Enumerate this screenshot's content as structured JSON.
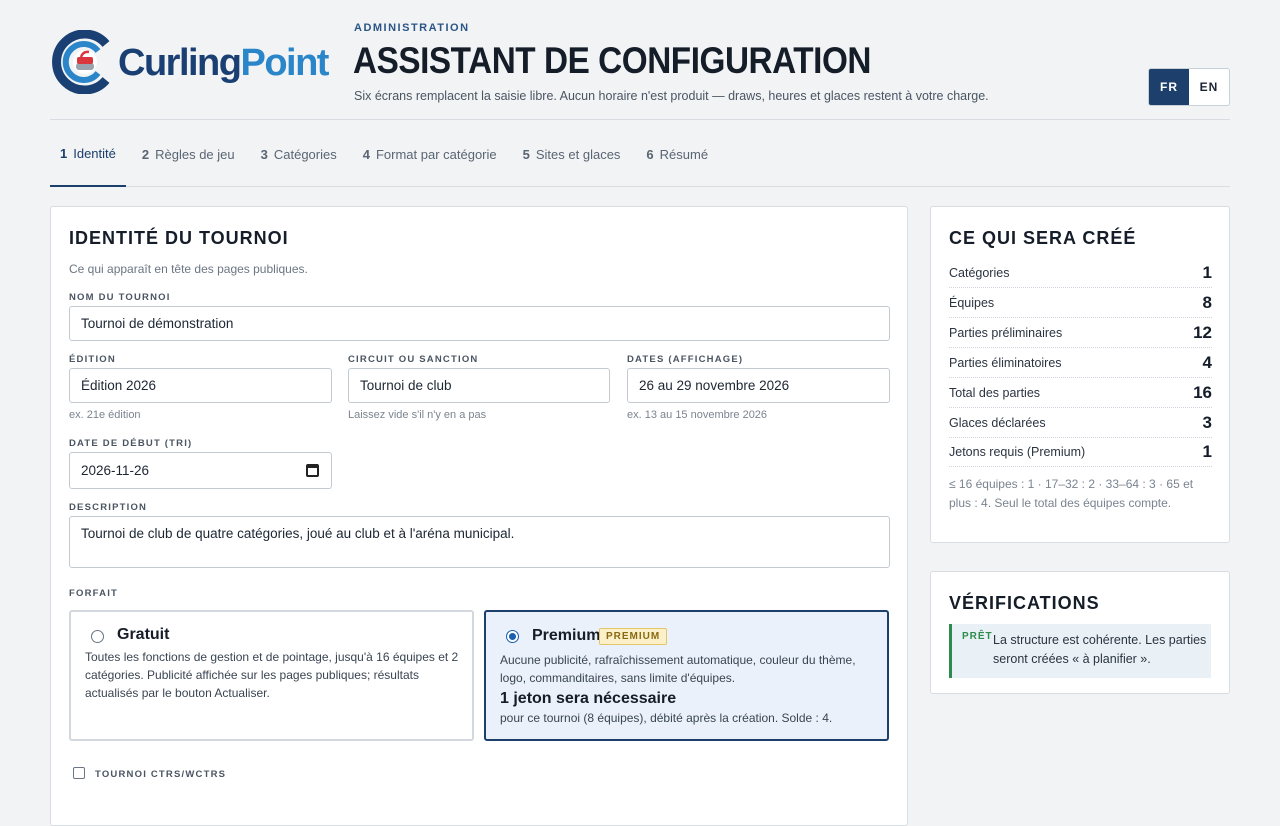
{
  "brand": {
    "name_part1": "Curling",
    "name_part2": "Point",
    "colors": {
      "navy": "#1a3f73",
      "blue": "#2a86c9",
      "accent_red": "#d9363e"
    }
  },
  "header": {
    "kicker": "ADMINISTRATION",
    "title": "ASSISTANT DE CONFIGURATION",
    "subtitle": "Six écrans remplacent la saisie libre. Aucun horaire n'est produit — draws, heures et glaces restent à votre charge."
  },
  "language": {
    "options": [
      "FR",
      "EN"
    ],
    "selected": "FR"
  },
  "tabs": [
    {
      "num": "1",
      "label": "Identité",
      "active": true
    },
    {
      "num": "2",
      "label": "Règles de jeu"
    },
    {
      "num": "3",
      "label": "Catégories"
    },
    {
      "num": "4",
      "label": "Format par catégorie"
    },
    {
      "num": "5",
      "label": "Sites et glaces"
    },
    {
      "num": "6",
      "label": "Résumé"
    }
  ],
  "form": {
    "title": "IDENTITÉ DU TOURNOI",
    "intro": "Ce qui apparaît en tête des pages publiques.",
    "name": {
      "label": "NOM DU TOURNOI",
      "value": "Tournoi de démonstration"
    },
    "edition": {
      "label": "ÉDITION",
      "value": "Édition 2026",
      "help": "ex. 21e édition"
    },
    "circuit": {
      "label": "CIRCUIT OU SANCTION",
      "value": "Tournoi de club",
      "help": "Laissez vide s'il n'y en a pas"
    },
    "dates": {
      "label": "DATES (AFFICHAGE)",
      "value": "26 au 29 novembre 2026",
      "help": "ex. 13 au 15 novembre 2026"
    },
    "start_date": {
      "label": "DATE DE DÉBUT (TRI)",
      "value": "2026-11-26"
    },
    "description": {
      "label": "DESCRIPTION",
      "value": "Tournoi de club de quatre catégories, joué au club et à l'aréna municipal."
    },
    "plan": {
      "label": "FORFAIT",
      "selected": "premium",
      "free": {
        "name": "Gratuit",
        "desc": "Toutes les fonctions de gestion et de pointage, jusqu'à 16 équipes et 2 catégories. Publicité affichée sur les pages publiques; résultats actualisés par le bouton Actualiser."
      },
      "premium": {
        "name": "Premium",
        "badge": "PREMIUM",
        "desc": "Aucune publicité, rafraîchissement automatique, couleur du thème, logo, commanditaires, sans limite d'équipes.",
        "token_heading": "1 jeton sera nécessaire",
        "token_detail": "pour ce tournoi (8 équipes), débité après la création. Solde : 4."
      }
    },
    "ctrs": {
      "label": "TOURNOI CTRS/WCTRS",
      "checked": false
    }
  },
  "summary": {
    "title": "CE QUI SERA CRÉÉ",
    "stats": [
      {
        "label": "Catégories",
        "value": "1"
      },
      {
        "label": "Équipes",
        "value": "8"
      },
      {
        "label": "Parties préliminaires",
        "value": "12"
      },
      {
        "label": "Parties éliminatoires",
        "value": "4"
      },
      {
        "label": "Total des parties",
        "value": "16"
      },
      {
        "label": "Glaces déclarées",
        "value": "3"
      },
      {
        "label": "Jetons requis (Premium)",
        "value": "1"
      }
    ],
    "note": "≤ 16 équipes : 1 · 17–32 : 2 · 33–64 : 3 · 65 et plus : 4. Seul le total des équipes compte."
  },
  "checks": {
    "title": "VÉRIFICATIONS",
    "status": "PRÊT",
    "message": "La structure est cohérente. Les parties seront créées « à planifier »."
  }
}
